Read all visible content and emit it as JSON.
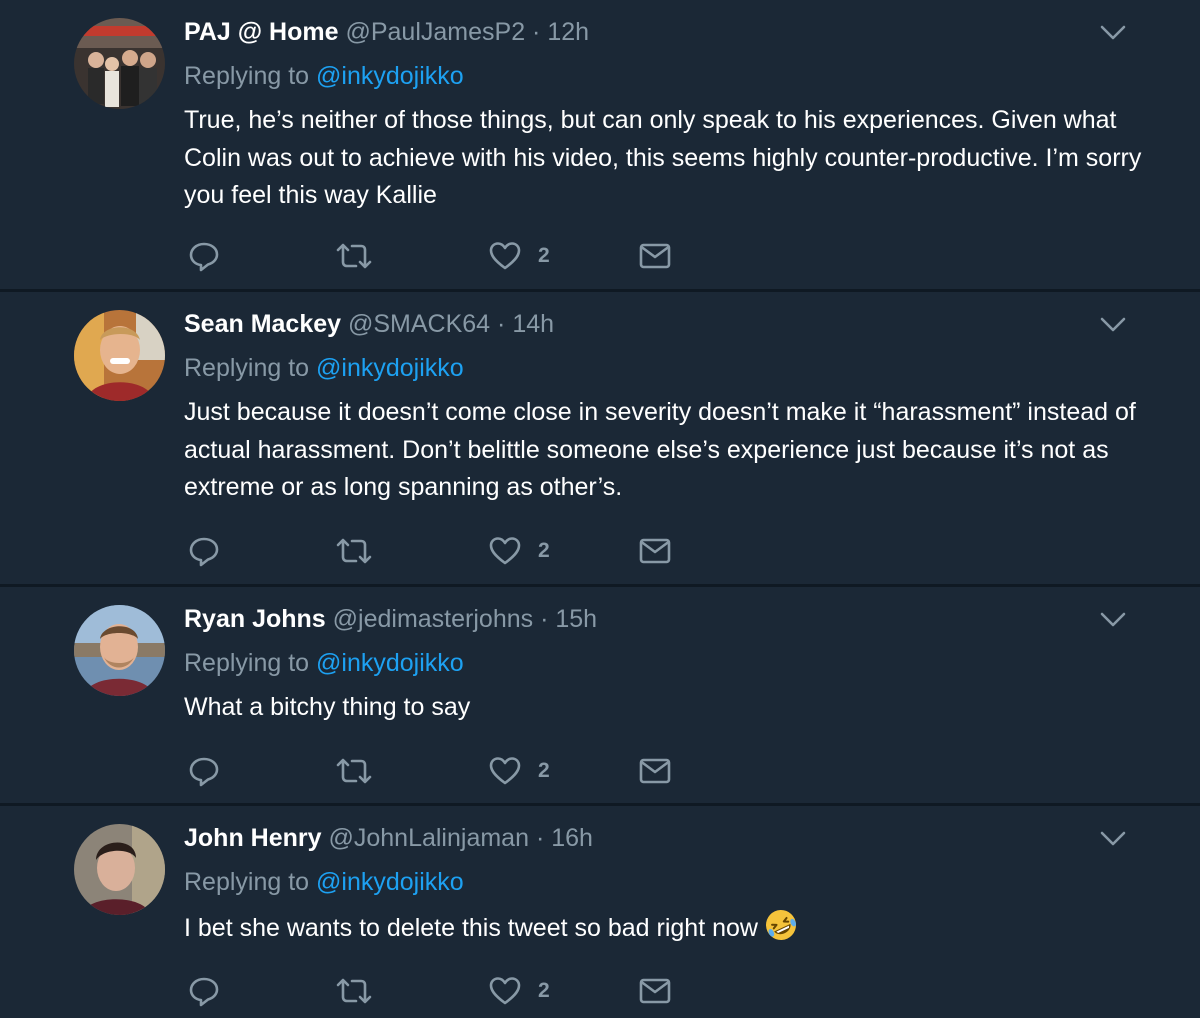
{
  "tweets": [
    {
      "name": "PAJ @ Home",
      "handle": "@PaulJamesP2",
      "time": "12h",
      "replying_prefix": "Replying to ",
      "replying_to": "@inkydojikko",
      "text": "True, he’s neither of those things, but can only speak to his experiences. Given what Colin was out to achieve with his video, this seems highly counter-productive. I’m sorry you feel this way Kallie",
      "likes": "2"
    },
    {
      "name": "Sean Mackey",
      "handle": "@SMACK64",
      "time": "14h",
      "replying_prefix": "Replying to ",
      "replying_to": "@inkydojikko",
      "text": "Just because it doesn’t come close in severity doesn’t make it “harassment” instead of actual harassment. Don’t belittle someone else’s experience just because it’s not as extreme or as long spanning as other’s.",
      "likes": "2"
    },
    {
      "name": "Ryan Johns",
      "handle": "@jedimasterjohns",
      "time": "15h",
      "replying_prefix": "Replying to ",
      "replying_to": "@inkydojikko",
      "text": "What a bitchy thing to say",
      "likes": "2"
    },
    {
      "name": "John Henry",
      "handle": "@JohnLalinjaman",
      "time": "16h",
      "replying_prefix": "Replying to ",
      "replying_to": "@inkydojikko",
      "text": "I bet she wants to delete this tweet so bad right now",
      "likes": "2",
      "emoji": "rolling-on-floor-laughing-icon"
    }
  ],
  "separator": " · ",
  "colors": {
    "background": "#1b2836",
    "divider": "#0f1923",
    "secondary_text": "#8899a6",
    "link": "#1da1f2",
    "primary_text": "#ffffff"
  },
  "icons": {
    "reply": "reply-icon",
    "retweet": "retweet-icon",
    "like": "heart-icon",
    "dm": "envelope-icon",
    "menu": "chevron-down-icon"
  }
}
